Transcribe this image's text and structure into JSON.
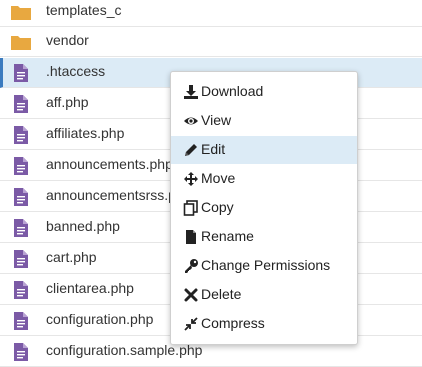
{
  "files": [
    {
      "name": "templates_c",
      "type": "folder"
    },
    {
      "name": "vendor",
      "type": "folder"
    },
    {
      "name": ".htaccess",
      "type": "file",
      "selected": true
    },
    {
      "name": "aff.php",
      "type": "file"
    },
    {
      "name": "affiliates.php",
      "type": "file"
    },
    {
      "name": "announcements.php",
      "type": "file"
    },
    {
      "name": "announcementsrss.php",
      "type": "file"
    },
    {
      "name": "banned.php",
      "type": "file"
    },
    {
      "name": "cart.php",
      "type": "file"
    },
    {
      "name": "clientarea.php",
      "type": "file"
    },
    {
      "name": "configuration.php",
      "type": "file"
    },
    {
      "name": "configuration.sample.php",
      "type": "file"
    }
  ],
  "context_menu": {
    "items": [
      {
        "label": "Download",
        "icon": "download-icon"
      },
      {
        "label": "View",
        "icon": "eye-icon"
      },
      {
        "label": "Edit",
        "icon": "pencil-icon",
        "hover": true
      },
      {
        "label": "Move",
        "icon": "move-arrows-icon"
      },
      {
        "label": "Copy",
        "icon": "copy-icon"
      },
      {
        "label": "Rename",
        "icon": "file-icon"
      },
      {
        "label": "Change Permissions",
        "icon": "key-icon"
      },
      {
        "label": "Delete",
        "icon": "x-icon"
      },
      {
        "label": "Compress",
        "icon": "compress-icon"
      }
    ]
  },
  "colors": {
    "folder": "#e8a840",
    "file_icon": "#7b5aa6",
    "selected_bg": "#dcebf6",
    "selected_border": "#3b7bbf"
  }
}
